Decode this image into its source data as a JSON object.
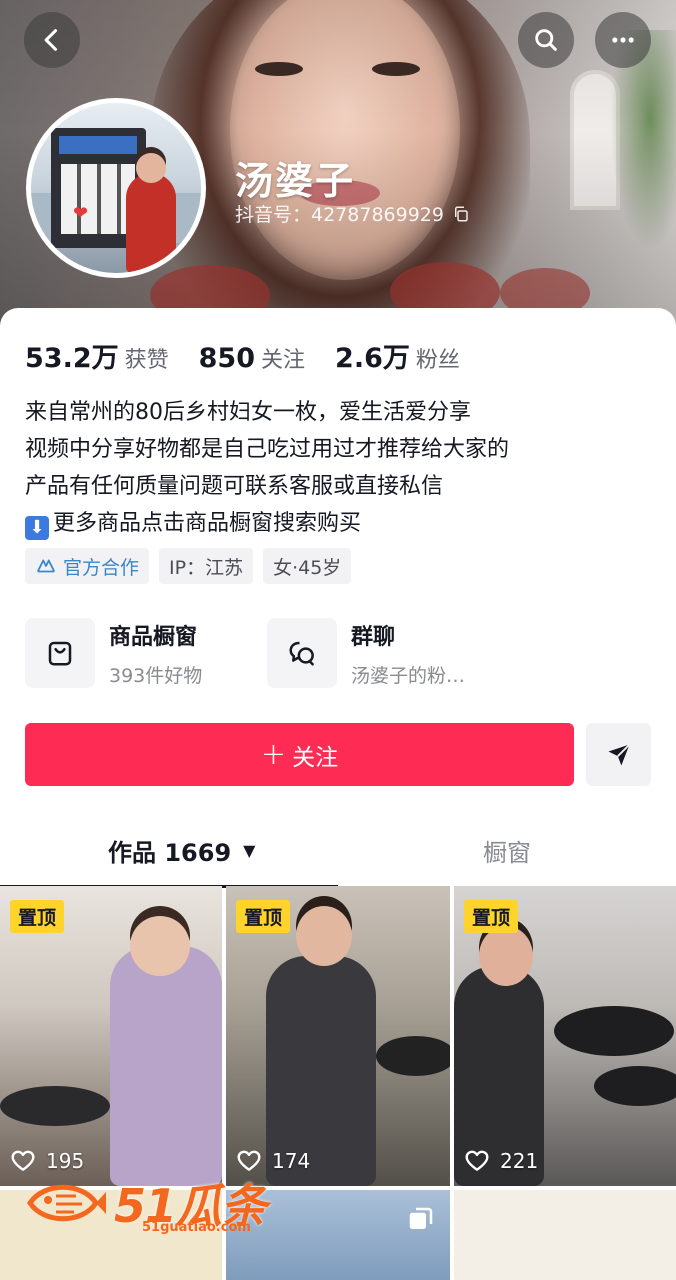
{
  "header": {
    "back_icon": "chevron-left-icon",
    "search_icon": "search-icon",
    "more_icon": "more-dots-icon",
    "nickname": "汤婆子",
    "douyin_id": "抖音号：42787869929",
    "copy_icon": "copy-icon"
  },
  "stats": [
    {
      "value": "53.2万",
      "label": "获赞"
    },
    {
      "value": "850",
      "label": "关注"
    },
    {
      "value": "2.6万",
      "label": "粉丝"
    }
  ],
  "bio": {
    "line1": "来自常州的80后乡村妇女一枚，爱生活爱分享",
    "line2": "视频中分享好物都是自己吃过用过才推荐给大家的",
    "line3": "产品有任何质量问题可联系客服或直接私信",
    "line4_emoji": "⬇",
    "line4": "更多商品点击商品橱窗搜索购买"
  },
  "tags": {
    "official": "官方合作",
    "ip": "IP：江苏",
    "gender_age": "女·45岁"
  },
  "entries": {
    "shop": {
      "title": "商品橱窗",
      "subtitle": "393件好物",
      "icon": "shopping-bag-icon"
    },
    "group": {
      "title": "群聊",
      "subtitle": "汤婆子的粉…",
      "icon": "chat-bubbles-icon"
    }
  },
  "actions": {
    "follow_label": "关注",
    "follow_plus": "+",
    "share_icon": "send-icon"
  },
  "tabs": {
    "works": "作品 1669",
    "works_caret": "▼",
    "window": "橱窗"
  },
  "videos": [
    {
      "pinned": "置顶",
      "likes": "195"
    },
    {
      "pinned": "置顶",
      "likes": "174"
    },
    {
      "pinned": "置顶",
      "likes": "221"
    }
  ],
  "watermark": {
    "text": "51瓜条",
    "sub": "51guatiao.com"
  },
  "colors": {
    "follow": "#fe2c55",
    "pin_badge": "#fed32c",
    "official": "#3b86c9"
  }
}
